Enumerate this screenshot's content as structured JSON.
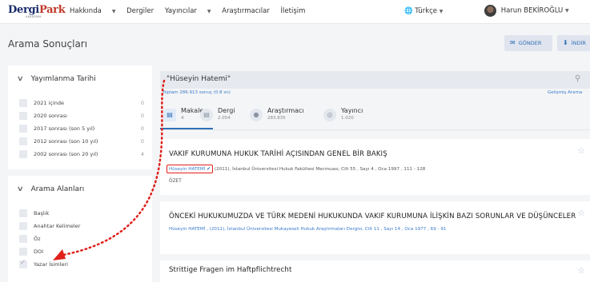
{
  "nav": {
    "logo_main_a": "Dergi",
    "logo_main_b": "Park",
    "logo_sub": "AKADEMİK",
    "items": [
      "Hakkında",
      "Dergiler",
      "Yayıncılar",
      "Araştırmacılar",
      "İletişim"
    ],
    "language": "Türkçe",
    "user_name": "Harun BEKİROĞLU"
  },
  "header": {
    "title": "Arama Sonuçları",
    "send_label": "GÖNDER",
    "download_label": "İNDİR"
  },
  "filters": {
    "date": {
      "title": "Yayımlanma Tarihi",
      "rows": [
        {
          "label": "2021 içinde",
          "count": "0"
        },
        {
          "label": "2020 sonrası",
          "count": "0"
        },
        {
          "label": "2017 sonrası (son 5 yıl)",
          "count": "0"
        },
        {
          "label": "2012 sonrası (son 10 yıl)",
          "count": "0"
        },
        {
          "label": "2002 sonrası (son 20 yıl)",
          "count": "4"
        }
      ]
    },
    "fields": {
      "title": "Arama Alanları",
      "rows": [
        {
          "label": "Başlık"
        },
        {
          "label": "Anahtar Kelimeler"
        },
        {
          "label": "Öz"
        },
        {
          "label": "DOI"
        },
        {
          "label": "Yazar İsimleri",
          "checked": true
        }
      ]
    }
  },
  "search": {
    "value": "\"Hüseyin Hatemi\"",
    "meta": "Toplam 286.913 sonuç (0.8 sn)",
    "advanced_label": "Gelişmiş Arama"
  },
  "tabs": [
    {
      "label": "Makale",
      "count": "4"
    },
    {
      "label": "Dergi",
      "count": "2.054"
    },
    {
      "label": "Araştırmacı",
      "count": "283.835"
    },
    {
      "label": "Yayıncı",
      "count": "1.020"
    }
  ],
  "results": [
    {
      "title": "VAKIF KURUMUNA HUKUK TARİHİ AÇISINDAN GENEL BİR BAKIŞ",
      "author": "Hüseyin HATEMİ",
      "meta_rest": "(2011), İstanbul Üniversitesi Hukuk Fakültesi Mecmuası, Cilt 55 , Sayı 4 , Oca 1997 , 111 - 128",
      "summary": "ÖZET"
    },
    {
      "title": "ÖNCEKİ HUKUKUMUZDA VE TÜRK MEDENİ HUKUKUNDA VAKIF KURUMUNA İLİŞKİN BAZI SORUNLAR VE DÜŞÜNCELER",
      "meta": "Hüseyin HATEMİ , (2011), İstanbul Üniversitesi Mukayeseli Hukuk Araştırmaları Dergisi, Cilt 11 , Sayı 14 , Oca 1977 , 69 - 91"
    },
    {
      "title": "Strittige Fragen im Haftpflichtrecht"
    }
  ],
  "colors": {
    "brand_navy": "#1b2c6b",
    "link_blue": "#3b7cc9",
    "annotation_red": "#e0201b"
  }
}
